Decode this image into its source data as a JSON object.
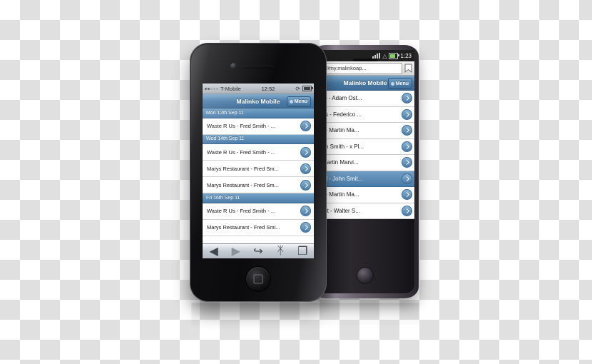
{
  "scene": {
    "description": "Two smartphones showing the Malinko Mobile web app",
    "devices": [
      "iphone",
      "android"
    ]
  },
  "android": {
    "status_bar": {
      "time": "1:23",
      "signal_icon": "signal-bars-icon",
      "wifi_icon": "wifi-icon",
      "battery_icon": "battery-icon"
    },
    "browser": {
      "url_value": "w://my.malinkoap...",
      "bookmark_icon": "bookmark-icon"
    },
    "app_bar": {
      "title": "Malinko Mobile",
      "menu_label": "Menu",
      "menu_icon": "bullet-dot-icon"
    },
    "rows": [
      {
        "text": "orp - Adam Ost...",
        "selected": false
      },
      {
        "text": "ries - Federico ...",
        "selected": false
      },
      {
        "text": "rp - Martin Ma...",
        "selected": false
      },
      {
        "text": "ohn Smith - x Pl...",
        "selected": false
      },
      {
        "text": "- Martin Marvi...",
        "selected": false
      },
      {
        "text": "ncil - John Smit...",
        "selected": true
      },
      {
        "text": "rp - Martin Ma...",
        "selected": false
      },
      {
        "text": "rant - Walter S...",
        "selected": false
      }
    ],
    "home_button_icon": "home-button-icon"
  },
  "iphone": {
    "status_bar": {
      "carrier": "T-Mobile",
      "time": "12:52",
      "signal_icon": "signal-dots-icon",
      "battery_icon": "battery-icon"
    },
    "app_bar": {
      "title": "Malinko Mobile",
      "menu_label": "Menu",
      "menu_icon": "bullet-dot-icon"
    },
    "list": [
      {
        "type": "header",
        "text": "Mon 12th Sep 11"
      },
      {
        "type": "item",
        "text": "Waste R Us - Fred Smith - ..."
      },
      {
        "type": "header",
        "text": "Wed 14th Sep 11"
      },
      {
        "type": "item",
        "text": "Waste R Us - Fred Smith - ..."
      },
      {
        "type": "item",
        "text": "Marys Restaurant - Fred Sm..."
      },
      {
        "type": "item",
        "text": "Marys Restaurant - Fred Sm..."
      },
      {
        "type": "header",
        "text": "Fri 16th Sep 11"
      },
      {
        "type": "item",
        "text": "Waste R Us - Fred Smith - ..."
      },
      {
        "type": "item",
        "text": "Marys Restaurant - Fred Smi..."
      }
    ],
    "toolbar": [
      {
        "icon": "back-arrow-icon",
        "label": "◀"
      },
      {
        "icon": "forward-arrow-icon",
        "label": "▶"
      },
      {
        "icon": "share-icon",
        "label": "↪"
      },
      {
        "icon": "bookmarks-icon",
        "label": "ᛡ"
      },
      {
        "icon": "tabs-icon",
        "label": "❐"
      }
    ],
    "home_button_icon": "home-button-icon"
  },
  "colors": {
    "accent_blue": "#4a7aa7",
    "header_blue": "#5f8fb8",
    "chrome_dark": "#1f1f1f"
  }
}
